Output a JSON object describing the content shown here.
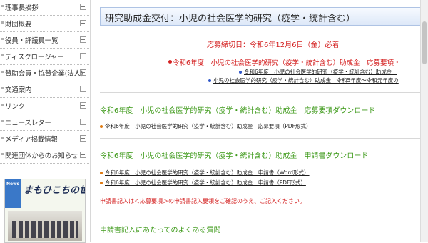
{
  "sidebar": {
    "items": [
      {
        "label": "理事長挨拶"
      },
      {
        "label": "財団概要"
      },
      {
        "label": "役員・評議員一覧"
      },
      {
        "label": "ディスクロージャー"
      },
      {
        "label": "賛助会員・協賛企業(法人)"
      },
      {
        "label": "交通案内"
      },
      {
        "label": "リンク"
      },
      {
        "label": "ニュースレター"
      },
      {
        "label": "メディア掲載情報"
      },
      {
        "label": "関連団体からのお知らせ"
      }
    ],
    "banner": {
      "badge": "News",
      "logo_text": "まもひこちの世紀"
    }
  },
  "main": {
    "title": "研究助成金交付：小児の社会医学的研究（疫学・統計含む）",
    "deadline": "応募締切日：令和6年12月6日（金）必着",
    "red_link": "令和6年度　小児の社会医学的研究（疫学・統計含む）助成金　応募要項・",
    "sub_links": [
      "令和6年度　小児の社会医学的研究（疫学・統計含む）助成金　",
      "小児の社会医学的研究（疫学・統計含む）助成金　令和5年度～令和元年度の"
    ],
    "section1": {
      "heading": "令和6年度　小児の社会医学的研究（疫学・統計含む）助成金　応募要項ダウンロード",
      "links": [
        "令和6年度　小児の社会医学的研究（疫学・統計含む）助成金　応募要項（PDF形式）"
      ]
    },
    "section2": {
      "heading": "令和6年度　小児の社会医学的研究（疫学・統計含む）助成金　申請書ダウンロード",
      "links": [
        "令和6年度　小児の社会医学的研究（疫学・統計含む）助成金　申請書（Word形式）",
        "令和6年度　小児の社会医学的研究（疫学・統計含む）助成金　申請書（PDF形式）"
      ]
    },
    "note": "申請書記入は＜応募要項＞の申請書記入要領をご確認のうえ、ご記入ください。",
    "faq_heading": "申請書記入にあたってのよくある質問"
  },
  "colors": {
    "accent_red": "#d42020",
    "heading_green": "#3e9a1a",
    "link_blue": "#2d55c8",
    "bullet_orange": "#e07a10"
  }
}
